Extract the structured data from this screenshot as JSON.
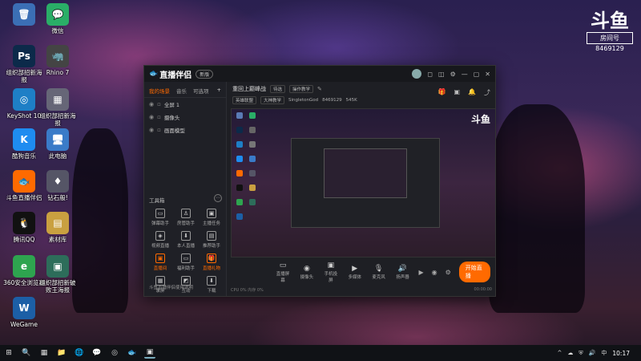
{
  "desktop": {
    "icons": [
      {
        "label": "",
        "glyph": "🗑",
        "color": "#3b6fb5"
      },
      {
        "label": "微信",
        "glyph": "💬",
        "color": "#2aae67"
      },
      {
        "label": "组织部招新海报",
        "glyph": "Ps",
        "color": "#0c2a4a"
      },
      {
        "label": "Rhino 7",
        "glyph": "🦏",
        "color": "#444"
      },
      {
        "label": "KeyShot 10",
        "glyph": "◎",
        "color": "#1e7fc6"
      },
      {
        "label": "组织部招新海报",
        "glyph": "▦",
        "color": "#667"
      },
      {
        "label": "酷狗音乐",
        "glyph": "K",
        "color": "#1e8cf0"
      },
      {
        "label": "此电脑",
        "glyph": "🖥",
        "color": "#3a7bc8"
      },
      {
        "label": "斗鱼直播伴侣",
        "glyph": "🐟",
        "color": "#ff6a00"
      },
      {
        "label": "钻石般!",
        "glyph": "♦",
        "color": "#556"
      },
      {
        "label": "腾讯QQ",
        "glyph": "🐧",
        "color": "#111"
      },
      {
        "label": "素材库",
        "glyph": "▤",
        "color": "#c9a040"
      },
      {
        "label": "360安全浏览器",
        "glyph": "e",
        "color": "#2ea44f"
      },
      {
        "label": "组织部招新破败王海报",
        "glyph": "▣",
        "color": "#2d6d5a"
      },
      {
        "label": "WeGame",
        "glyph": "W",
        "color": "#1c5fa6"
      }
    ]
  },
  "watermark": {
    "logo": "斗鱼",
    "room_label": "房间号",
    "room_number": "8469129"
  },
  "app": {
    "title": "直播伴侣",
    "version": "新版",
    "titlebar_icons": [
      "◻",
      "◫",
      "⚙",
      "—",
      "▢",
      "✕"
    ],
    "tabs": [
      "我的场景",
      "音乐",
      "可选项"
    ],
    "scenes": [
      "全屏 1",
      "摄像头",
      "画面模型"
    ],
    "tools_heading": "工具箱",
    "tools": [
      {
        "label": "弹幕助手",
        "glyph": "▭",
        "highlight": false
      },
      {
        "label": "房管助手",
        "glyph": "♙",
        "highlight": false
      },
      {
        "label": "主播任务",
        "glyph": "▣",
        "highlight": false
      },
      {
        "label": "视频直播",
        "glyph": "◈",
        "highlight": false
      },
      {
        "label": "本人直播",
        "glyph": "⬇",
        "highlight": false
      },
      {
        "label": "推荐助手",
        "glyph": "▤",
        "highlight": false
      },
      {
        "label": "直播间",
        "glyph": "▣",
        "highlight": true
      },
      {
        "label": "福利助手",
        "glyph": "▭",
        "highlight": false
      },
      {
        "label": "直播礼物",
        "glyph": "🎁",
        "highlight": true
      },
      {
        "label": "录屏",
        "glyph": "▦",
        "highlight": false
      },
      {
        "label": "互动",
        "glyph": "◩",
        "highlight": false
      },
      {
        "label": "下载",
        "glyph": "⬇",
        "highlight": false
      }
    ],
    "sidebar_footer": "斗鱼直播伴侣使用说明",
    "info": {
      "title": "重回上巅峰战",
      "tag1": "待选",
      "tag2": "操作教学",
      "chip1": "英雄联盟",
      "chip2": "大神教学",
      "user": "SingletonGod",
      "room": "8469129",
      "fans": "545K"
    },
    "controls": [
      {
        "label": "直播屏幕",
        "glyph": "▭"
      },
      {
        "label": "摄像头",
        "glyph": "◉"
      },
      {
        "label": "手机投屏",
        "glyph": "▣"
      },
      {
        "label": "多媒体",
        "glyph": "▶"
      },
      {
        "label": "麦克风",
        "glyph": "🎙"
      },
      {
        "label": "扬声器",
        "glyph": "🔊"
      }
    ],
    "start_label": "开始直播",
    "status_left": "CPU 0%  内存 0%",
    "status_right": "00:00:00"
  },
  "taskbar": {
    "apps": [
      "⊞",
      "🔍",
      "▦",
      "📁",
      "🌐",
      "💬",
      "◎",
      "🐟",
      "▣"
    ],
    "tray": [
      "^",
      "☁",
      "⛨",
      "🔊",
      "中"
    ],
    "time": "10:17"
  }
}
